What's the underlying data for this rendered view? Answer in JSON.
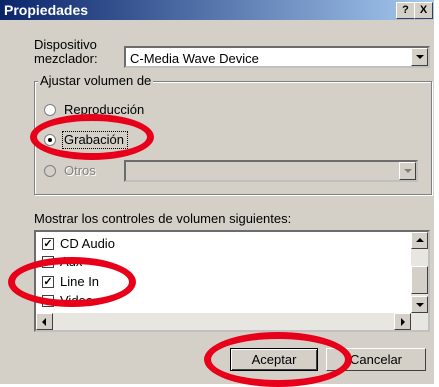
{
  "window": {
    "title": "Propiedades",
    "help_label": "?",
    "close_label": "X"
  },
  "mixer": {
    "label_line1": "Dispositivo",
    "label_line2": "mezclador:",
    "value": "C-Media Wave Device"
  },
  "adjust_group": {
    "title": "Ajustar volumen de",
    "options": [
      {
        "label": "Reproducción",
        "checked": false,
        "enabled": true
      },
      {
        "label": "Grabación",
        "checked": true,
        "enabled": true
      },
      {
        "label": "Otros",
        "checked": false,
        "enabled": false
      }
    ],
    "otros_value": ""
  },
  "controls": {
    "label": "Mostrar los controles de volumen siguientes:",
    "items": [
      {
        "label": "CD Audio",
        "checked": true
      },
      {
        "label": "Aux",
        "checked": false
      },
      {
        "label": "Line In",
        "checked": true
      },
      {
        "label": "Video",
        "checked": false
      }
    ]
  },
  "buttons": {
    "ok": "Aceptar",
    "cancel": "Cancelar"
  },
  "colors": {
    "highlight": "#e8001a",
    "title_start": "#0a246a",
    "face": "#d4d0c8"
  }
}
